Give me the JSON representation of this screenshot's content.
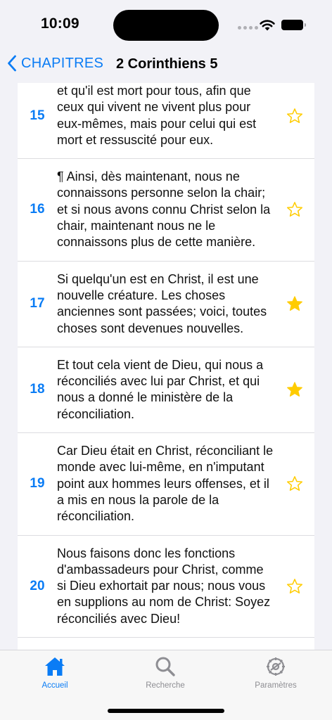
{
  "status_bar": {
    "time": "10:09"
  },
  "nav": {
    "back_label": "CHAPITRES",
    "title": "2 Corinthiens 5"
  },
  "verses": [
    {
      "number": "15",
      "text": "et qu'il est mort pour tous, afin que ceux qui vivent ne vivent plus pour eux-mêmes, mais pour celui qui est mort et ressuscité pour eux.",
      "favorite": false
    },
    {
      "number": "16",
      "text": "¶ Ainsi, dès maintenant, nous ne connaissons personne selon la chair; et si nous avons connu Christ selon la chair, maintenant nous ne le connaissons plus de cette manière.",
      "favorite": false
    },
    {
      "number": "17",
      "text": "Si quelqu'un est en Christ, il est une nouvelle créature. Les choses anciennes sont passées; voici, toutes choses sont devenues nouvelles.",
      "favorite": true
    },
    {
      "number": "18",
      "text": "Et tout cela vient de Dieu, qui nous a réconciliés avec lui par Christ, et qui nous a donné le ministère de la réconciliation.",
      "favorite": true
    },
    {
      "number": "19",
      "text": "Car Dieu était en Christ, réconciliant le monde avec lui-même, en n'imputant point aux hommes leurs offenses, et il a mis en nous la parole de la réconciliation.",
      "favorite": false
    },
    {
      "number": "20",
      "text": "Nous faisons donc les fonctions d'ambassadeurs pour Christ, comme si Dieu exhortait par nous; nous vous en supplions au nom de Christ: Soyez réconciliés avec Dieu!",
      "favorite": false
    }
  ],
  "tabs": [
    {
      "label": "Accueil",
      "icon": "house-icon",
      "active": true
    },
    {
      "label": "Recherche",
      "icon": "magnifier-icon",
      "active": false
    },
    {
      "label": "Paramètres",
      "icon": "gear-icon",
      "active": false
    }
  ],
  "colors": {
    "accent": "#0a7cf5",
    "star": "#ffcc00",
    "inactive": "#8e8e93"
  }
}
